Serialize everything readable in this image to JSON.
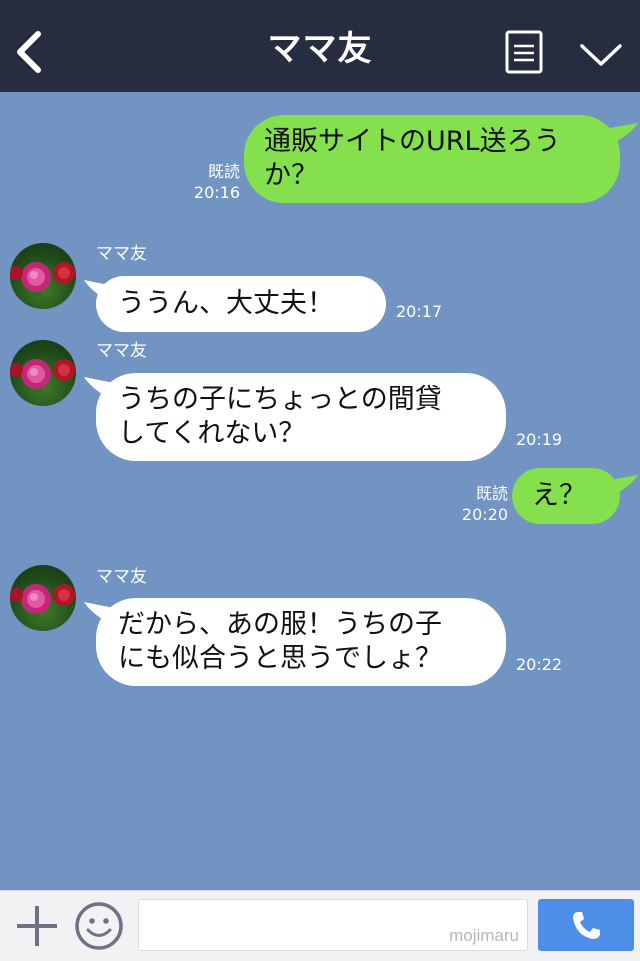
{
  "header": {
    "title": "ママ友",
    "back_icon": "chevron-left-icon",
    "menu_icon": "list-icon",
    "dropdown_icon": "chevron-down-icon"
  },
  "messages": [
    {
      "direction": "out",
      "lines": [
        "通販サイトのURL送ろう",
        "か？"
      ],
      "read": "既読",
      "time": "20:16"
    },
    {
      "direction": "in",
      "sender": "ママ友",
      "lines": [
        "ううん、大丈夫！"
      ],
      "time": "20:17"
    },
    {
      "direction": "in",
      "sender": "ママ友",
      "lines": [
        "うちの子にちょっとの間貸",
        "してくれない？"
      ],
      "time": "20:19"
    },
    {
      "direction": "out",
      "lines": [
        "え？"
      ],
      "read": "既読",
      "time": "20:20"
    },
    {
      "direction": "in",
      "sender": "ママ友",
      "lines": [
        "だから、あの服！うちの子",
        "にも似合うと思うでしょ？"
      ],
      "time": "20:22"
    }
  ],
  "footer": {
    "plus_icon": "plus-icon",
    "emoji_icon": "smiley-icon",
    "watermark": "mojimaru",
    "call_icon": "phone-icon"
  },
  "colors": {
    "header_bg": "#262d40",
    "chat_bg": "#7194c2",
    "outgoing_bubble": "#84e04c",
    "incoming_bubble": "#ffffff",
    "call_button": "#4d8ee8"
  }
}
